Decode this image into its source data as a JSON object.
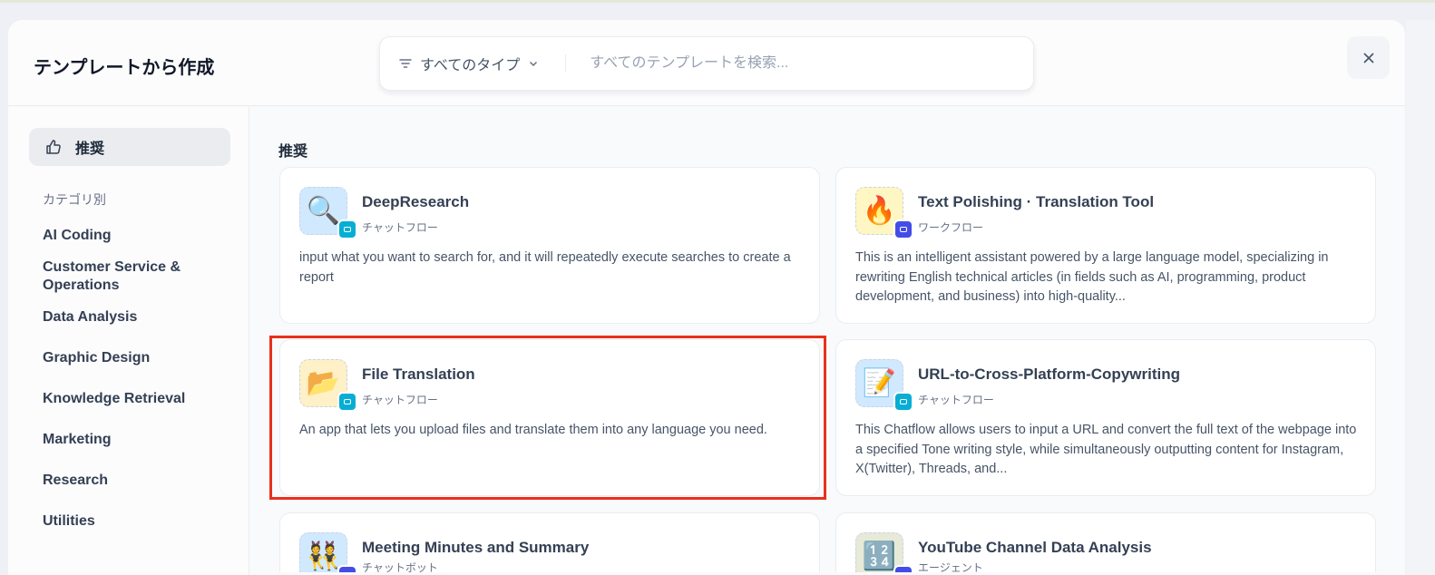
{
  "header": {
    "title": "テンプレートから作成",
    "type_filter": "すべてのタイプ",
    "search_placeholder": "すべてのテンプレートを検索..."
  },
  "sidebar": {
    "recommended": "推奨",
    "category_label": "カテゴリ別",
    "categories": [
      "AI Coding",
      "Customer Service & Operations",
      "Data Analysis",
      "Graphic Design",
      "Knowledge Retrieval",
      "Marketing",
      "Research",
      "Utilities"
    ]
  },
  "main": {
    "section_title": "推奨",
    "cards": [
      {
        "name": "DeepResearch",
        "type": "チャットフロー",
        "icon": "🔍",
        "desc": "input what you want to search for, and it will repeatedly execute searches to create a report",
        "bg": "#d1e9ff",
        "badge": "#06aed4"
      },
      {
        "name": "Text Polishing · Translation Tool",
        "type": "ワークフロー",
        "icon": "🔥",
        "desc": "This is an intelligent assistant powered by a large language model, specializing in rewriting English technical articles (in fields such as AI, programming, product development, and business) into high-quality...",
        "bg": "#fef7c3",
        "badge": "#444ce7"
      },
      {
        "name": "File Translation",
        "type": "チャットフロー",
        "icon": "📂",
        "desc": "An app that lets you upload files and translate them into any language you need.",
        "bg": "#fef0c7",
        "badge": "#06aed4"
      },
      {
        "name": "URL-to-Cross-Platform-Copywriting",
        "type": "チャットフロー",
        "icon": "📝",
        "desc": "This Chatflow allows users to input a URL and convert the full text of the webpage into a specified Tone writing style, while simultaneously outputting content for Instagram, X(Twitter), Threads, and...",
        "bg": "#d1e9ff",
        "badge": "#06aed4"
      },
      {
        "name": "Meeting Minutes and Summary",
        "type": "チャットボット",
        "icon": "👯",
        "desc": "",
        "bg": "#d1e9ff",
        "badge": "#444ce7"
      },
      {
        "name": "YouTube Channel Data Analysis",
        "type": "エージェント",
        "icon": "🔢",
        "desc": "",
        "bg": "#e6ead6",
        "badge": "#444ce7"
      }
    ]
  }
}
